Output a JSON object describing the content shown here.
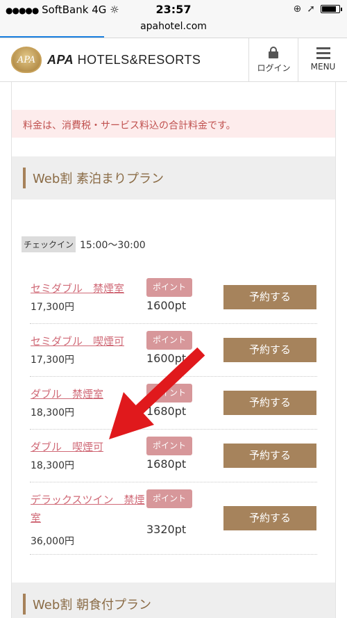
{
  "status": {
    "carrier": "SoftBank",
    "network": "4G",
    "time": "23:57",
    "battery_fraction": 0.85
  },
  "browser": {
    "url": "apahotel.com",
    "load_progress": 0.3
  },
  "header": {
    "crest_text": "APA",
    "brand_bold": "APA",
    "brand_rest": " HOTELS&RESORTS",
    "login_label": "ログイン",
    "menu_label": "MENU"
  },
  "notice": "料金は、消費税・サービス料込の合計料金です。",
  "plan1": {
    "title": "Web割 素泊まりプラン",
    "checkin_tag": "チェックイン",
    "checkin_time": "15:00〜30:00",
    "rooms": [
      {
        "name": "セミダブル　禁煙室",
        "price": "17,300円",
        "badge": "ポイント",
        "points": "1600pt",
        "button": "予約する"
      },
      {
        "name": "セミダブル　喫煙可",
        "price": "17,300円",
        "badge": "ポイント",
        "points": "1600pt",
        "button": "予約する"
      },
      {
        "name": "ダブル　禁煙室",
        "price": "18,300円",
        "badge": "ポイント",
        "points": "1680pt",
        "button": "予約する"
      },
      {
        "name": "ダブル　喫煙可",
        "price": "18,300円",
        "badge": "ポイント",
        "points": "1680pt",
        "button": "予約する"
      },
      {
        "name": "デラックスツイン　禁煙室",
        "price": "36,000円",
        "badge": "ポイント",
        "points": "3320pt",
        "button": "予約する"
      }
    ]
  },
  "plan2": {
    "title": "Web割 朝食付プラン"
  },
  "colors": {
    "accent_brown": "#a6835c",
    "room_link": "#d06a77",
    "badge": "#d7979a",
    "notice_bg": "#fdecec",
    "arrow": "#e0191c"
  },
  "icons": [
    "signal-dots-icon",
    "loading-icon",
    "lock-rotation-icon",
    "location-icon",
    "battery-icon",
    "lock-icon",
    "hamburger-menu-icon",
    "red-arrow-annotation"
  ]
}
